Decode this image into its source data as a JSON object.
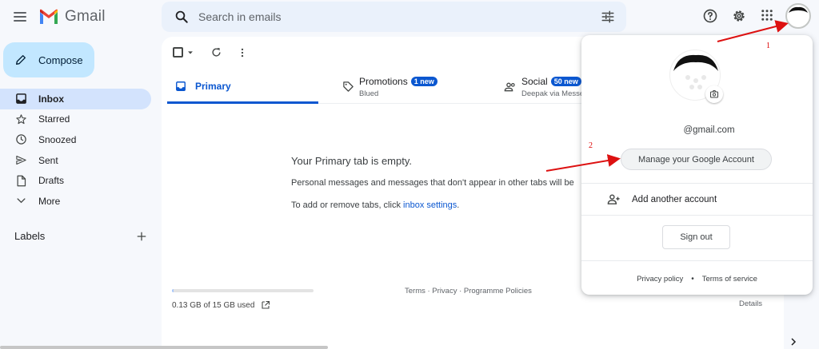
{
  "app": {
    "logo_text": "Gmail",
    "brand_colors": {
      "red": "#ea4335",
      "blue": "#4285f4",
      "green": "#34a853",
      "yellow": "#fbbc04"
    }
  },
  "search": {
    "placeholder": "Search in emails",
    "value": ""
  },
  "header_icons": [
    "menu-icon",
    "search-icon",
    "tune-icon",
    "help-icon",
    "settings-icon",
    "apps-icon",
    "account-avatar"
  ],
  "sidebar": {
    "compose_label": "Compose",
    "items": [
      {
        "label": "Inbox",
        "icon": "inbox-icon",
        "active": true
      },
      {
        "label": "Starred",
        "icon": "star-icon",
        "active": false
      },
      {
        "label": "Snoozed",
        "icon": "clock-icon",
        "active": false
      },
      {
        "label": "Sent",
        "icon": "send-icon",
        "active": false
      },
      {
        "label": "Drafts",
        "icon": "draft-icon",
        "active": false
      },
      {
        "label": "More",
        "icon": "chevron-down-icon",
        "active": false
      }
    ],
    "labels_heading": "Labels"
  },
  "tabs": [
    {
      "label": "Primary",
      "active": true,
      "icon": "inbox-icon"
    },
    {
      "label": "Promotions",
      "badge": "1 new",
      "subtext": "Blued",
      "icon": "tag-icon"
    },
    {
      "label": "Social",
      "badge": "50 new",
      "subtext": "Deepak via Messe",
      "icon": "people-icon"
    }
  ],
  "empty_state": {
    "title": "Your Primary tab is empty.",
    "line1": "Personal messages and messages that don't appear in other tabs will be",
    "line2_prefix": "To add or remove tabs, click ",
    "line2_link": "inbox settings",
    "line2_suffix": "."
  },
  "storage": {
    "text": "0.13 GB of 15 GB used",
    "used_fraction": 0.009
  },
  "footer": {
    "links": "Terms · Privacy · Programme Policies",
    "details": "Details"
  },
  "account_popup": {
    "email": "@gmail.com",
    "manage_label": "Manage your Google Account",
    "add_account_label": "Add another account",
    "sign_out_label": "Sign out",
    "privacy_label": "Privacy policy",
    "terms_label": "Terms of service"
  },
  "annotations": {
    "step1": "1",
    "step2": "2",
    "arrow_color": "#dd1111"
  }
}
